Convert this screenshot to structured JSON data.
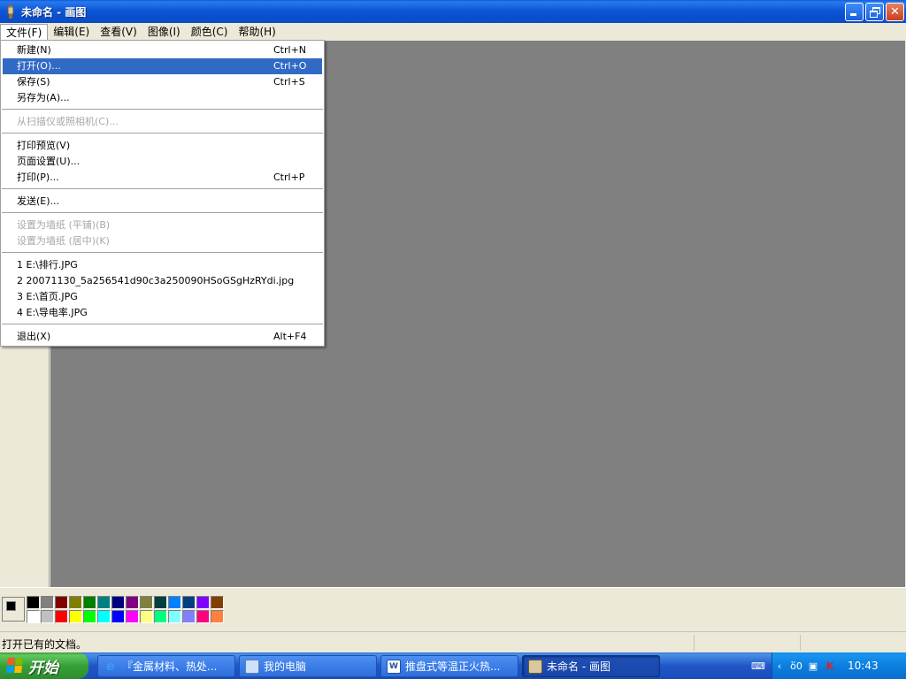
{
  "window": {
    "title": "未命名 - 画图"
  },
  "menubar": {
    "items": [
      "文件(F)",
      "编辑(E)",
      "查看(V)",
      "图像(I)",
      "颜色(C)",
      "帮助(H)"
    ]
  },
  "file_menu": {
    "items": [
      {
        "label": "新建(N)",
        "shortcut": "Ctrl+N"
      },
      {
        "label": "打开(O)...",
        "shortcut": "Ctrl+O"
      },
      {
        "label": "保存(S)",
        "shortcut": "Ctrl+S"
      },
      {
        "label": "另存为(A)...",
        "shortcut": ""
      },
      {
        "label": "从扫描仪或照相机(C)...",
        "shortcut": ""
      },
      {
        "label": "打印预览(V)",
        "shortcut": ""
      },
      {
        "label": "页面设置(U)...",
        "shortcut": ""
      },
      {
        "label": "打印(P)...",
        "shortcut": "Ctrl+P"
      },
      {
        "label": "发送(E)...",
        "shortcut": ""
      },
      {
        "label": "设置为墙纸 (平铺)(B)",
        "shortcut": ""
      },
      {
        "label": "设置为墙纸 (居中)(K)",
        "shortcut": ""
      },
      {
        "label": "1 E:\\排行.JPG",
        "shortcut": ""
      },
      {
        "label": "2 20071130_5a256541d90c3a250090HSoGSgHzRYdi.jpg",
        "shortcut": ""
      },
      {
        "label": "3 E:\\首页.JPG",
        "shortcut": ""
      },
      {
        "label": "4 E:\\导电率.JPG",
        "shortcut": ""
      },
      {
        "label": "退出(X)",
        "shortcut": "Alt+F4"
      }
    ]
  },
  "palette": {
    "foreground": "#000000",
    "background": "#ffffff",
    "top_row": [
      "#000000",
      "#808080",
      "#800000",
      "#808000",
      "#008000",
      "#008080",
      "#000080",
      "#800080",
      "#808040",
      "#004040",
      "#0080ff",
      "#004080",
      "#8000ff",
      "#804000"
    ],
    "bottom_row": [
      "#ffffff",
      "#c0c0c0",
      "#ff0000",
      "#ffff00",
      "#00ff00",
      "#00ffff",
      "#0000ff",
      "#ff00ff",
      "#ffff80",
      "#00ff80",
      "#80ffff",
      "#8080ff",
      "#ff0080",
      "#ff8040"
    ]
  },
  "status": {
    "text": "打开已有的文档。"
  },
  "taskbar": {
    "start_label": "开始",
    "buttons": [
      {
        "label": "『金属材料、热处...",
        "icon": "ie-icon"
      },
      {
        "label": "我的电脑",
        "icon": "my-computer-icon"
      },
      {
        "label": "推盘式等温正火热...",
        "icon": "document-icon"
      },
      {
        "label": "未命名 - 画图",
        "icon": "paint-icon"
      }
    ],
    "clock": "10:43"
  }
}
